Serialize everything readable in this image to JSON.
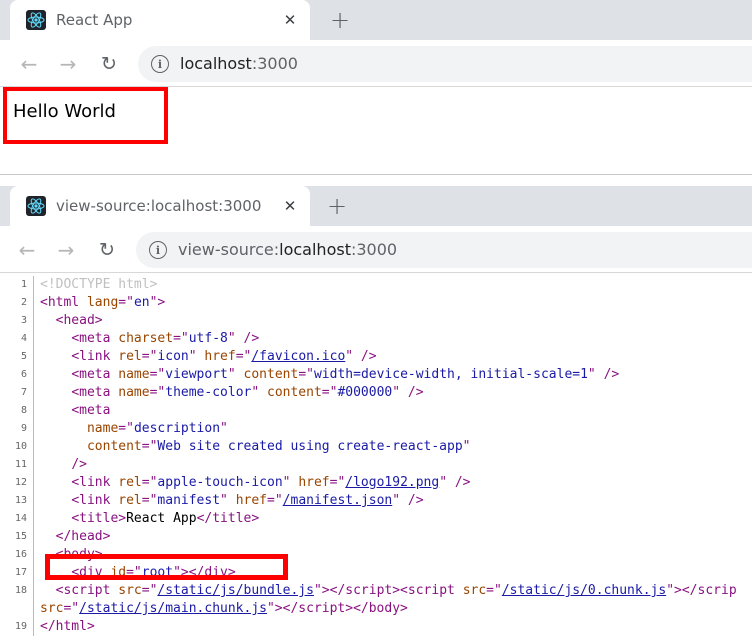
{
  "top_window": {
    "tab": {
      "title": "React App",
      "close": "✕"
    },
    "new_tab": "+",
    "address": {
      "host": "localhost",
      "port": ":3000"
    },
    "page": {
      "text": "Hello World"
    }
  },
  "bottom_window": {
    "tab": {
      "title": "view-source:localhost:3000",
      "close": "✕"
    },
    "new_tab": "+",
    "address": {
      "prefix": "view-source:",
      "host": "localhost",
      "port": ":3000"
    }
  },
  "source_lines": [
    {
      "n": "1",
      "html": "<span class='dt'>&lt;!DOCTYPE html&gt;</span>"
    },
    {
      "n": "2",
      "html": "<span class='t'>&lt;html</span> <span class='a'>lang</span><span class='t'>=\"</span><span class='v'>en</span><span class='t'>\"&gt;</span>"
    },
    {
      "n": "3",
      "html": "  <span class='t'>&lt;head&gt;</span>"
    },
    {
      "n": "4",
      "html": "    <span class='t'>&lt;meta</span> <span class='a'>charset</span><span class='t'>=\"</span><span class='v'>utf-8</span><span class='t'>\" /&gt;</span>"
    },
    {
      "n": "5",
      "html": "    <span class='t'>&lt;link</span> <span class='a'>rel</span><span class='t'>=\"</span><span class='v'>icon</span><span class='t'>\"</span> <span class='a'>href</span><span class='t'>=\"</span><span class='l'>/favicon.ico</span><span class='t'>\" /&gt;</span>"
    },
    {
      "n": "6",
      "html": "    <span class='t'>&lt;meta</span> <span class='a'>name</span><span class='t'>=\"</span><span class='v'>viewport</span><span class='t'>\"</span> <span class='a'>content</span><span class='t'>=\"</span><span class='v'>width=device-width, initial-scale=1</span><span class='t'>\" /&gt;</span>"
    },
    {
      "n": "7",
      "html": "    <span class='t'>&lt;meta</span> <span class='a'>name</span><span class='t'>=\"</span><span class='v'>theme-color</span><span class='t'>\"</span> <span class='a'>content</span><span class='t'>=\"</span><span class='v'>#000000</span><span class='t'>\" /&gt;</span>"
    },
    {
      "n": "8",
      "html": "    <span class='t'>&lt;meta</span>"
    },
    {
      "n": "9",
      "html": "      <span class='a'>name</span><span class='t'>=\"</span><span class='v'>description</span><span class='t'>\"</span>"
    },
    {
      "n": "10",
      "html": "      <span class='a'>content</span><span class='t'>=\"</span><span class='v'>Web site created using create-react-app</span><span class='t'>\"</span>"
    },
    {
      "n": "11",
      "html": "    <span class='t'>/&gt;</span>"
    },
    {
      "n": "12",
      "html": "    <span class='t'>&lt;link</span> <span class='a'>rel</span><span class='t'>=\"</span><span class='v'>apple-touch-icon</span><span class='t'>\"</span> <span class='a'>href</span><span class='t'>=\"</span><span class='l'>/logo192.png</span><span class='t'>\" /&gt;</span>"
    },
    {
      "n": "13",
      "html": "    <span class='t'>&lt;link</span> <span class='a'>rel</span><span class='t'>=\"</span><span class='v'>manifest</span><span class='t'>\"</span> <span class='a'>href</span><span class='t'>=\"</span><span class='l'>/manifest.json</span><span class='t'>\" /&gt;</span>"
    },
    {
      "n": "14",
      "html": "    <span class='t'>&lt;title&gt;</span><span class='txt'>React App</span><span class='t'>&lt;/title&gt;</span>"
    },
    {
      "n": "15",
      "html": "  <span class='t'>&lt;/head&gt;</span>"
    },
    {
      "n": "16",
      "html": "  <span class='t'>&lt;body&gt;</span>"
    },
    {
      "n": "17",
      "html": "    <span class='t'>&lt;div</span> <span class='a'>id</span><span class='t'>=\"</span><span class='v'>root</span><span class='t'>\"&gt;&lt;/div&gt;</span>"
    },
    {
      "n": "18",
      "html": "  <span class='t'>&lt;script</span> <span class='a'>src</span><span class='t'>=\"</span><span class='l'>/static/js/bundle.js</span><span class='t'>\"&gt;&lt;/script&gt;&lt;script</span> <span class='a'>src</span><span class='t'>=\"</span><span class='l'>/static/js/0.chunk.js</span><span class='t'>\"&gt;&lt;/scrip</span>"
    },
    {
      "n": "",
      "html": "<span class='a'>src</span><span class='t'>=\"</span><span class='l'>/static/js/main.chunk.js</span><span class='t'>\"&gt;&lt;/script&gt;&lt;/body&gt;</span>"
    },
    {
      "n": "19",
      "html": "<span class='t'>&lt;/html&gt;</span>"
    }
  ],
  "colors": {
    "highlight": "#ff0000",
    "tabstrip": "#dee1e6",
    "omnibox": "#f1f3f4"
  },
  "icons": {
    "favicon": "react-logo-icon",
    "info": "info-icon",
    "back": "back-arrow-icon",
    "forward": "forward-arrow-icon",
    "reload": "reload-icon"
  }
}
